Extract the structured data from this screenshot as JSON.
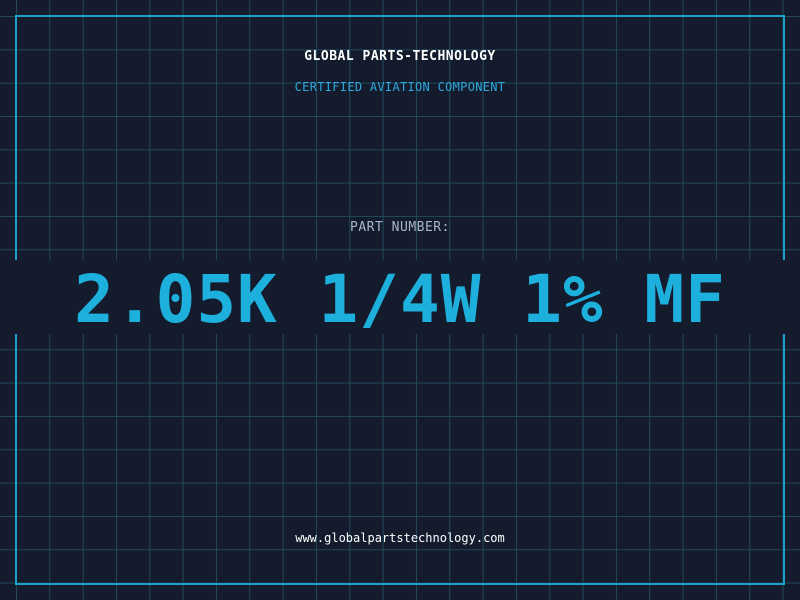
{
  "header": {
    "company_name": "GLOBAL PARTS-TECHNOLOGY",
    "tagline": "CERTIFIED AVIATION COMPONENT"
  },
  "part": {
    "label": "PART NUMBER:",
    "number": "2.05K 1/4W 1% MF"
  },
  "footer": {
    "website": "www.globalpartstechnology.com"
  },
  "colors": {
    "background": "#131b2d",
    "grid": "#1f4a5c",
    "accent": "#1eb0dc",
    "frame": "#1fa0c8"
  }
}
